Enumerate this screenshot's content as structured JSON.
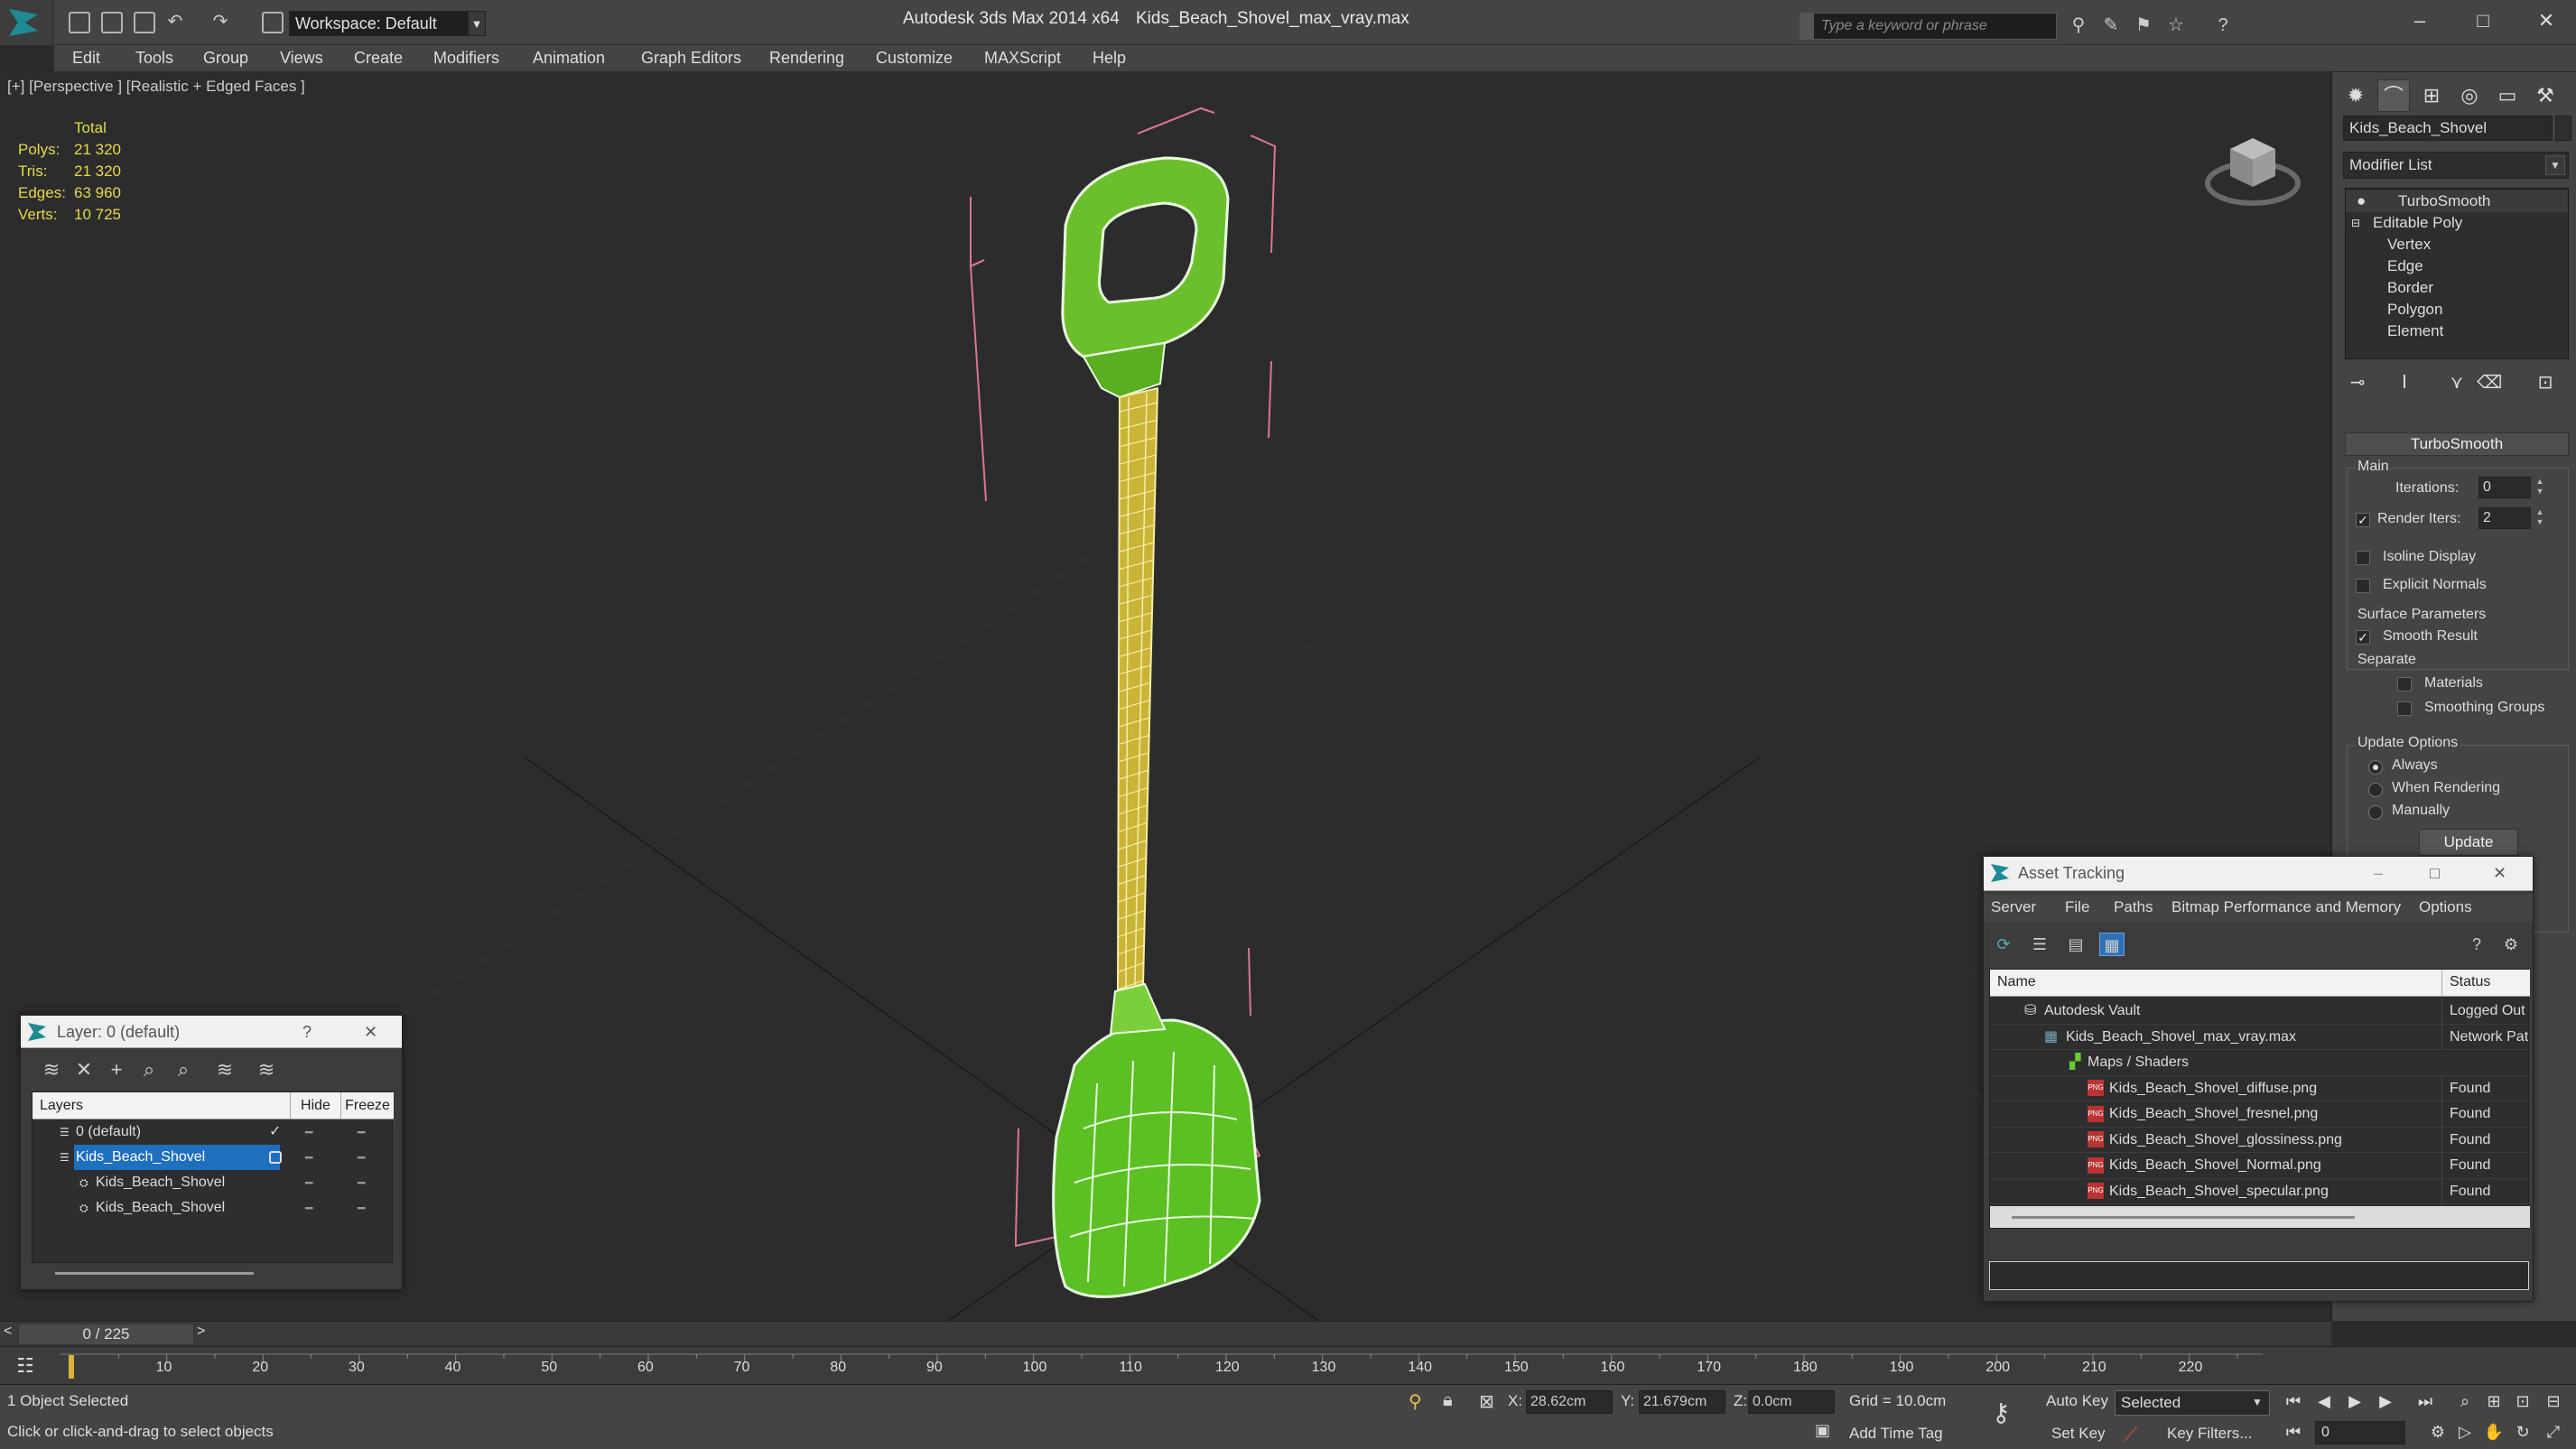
{
  "app": {
    "title": "Autodesk 3ds Max  2014 x64",
    "file": "Kids_Beach_Shovel_max_vray.max",
    "workspace": "Workspace: Default",
    "search_placeholder": "Type a keyword or phrase"
  },
  "menu": [
    "Edit",
    "Tools",
    "Group",
    "Views",
    "Create",
    "Modifiers",
    "Animation",
    "Graph Editors",
    "Rendering",
    "Customize",
    "MAXScript",
    "Help"
  ],
  "viewport": {
    "label": "[+] [Perspective ] [Realistic + Edged Faces ]",
    "stats_header": "Total",
    "stats": [
      {
        "k": "Polys:",
        "v": "21 320"
      },
      {
        "k": "Tris:",
        "v": "21 320"
      },
      {
        "k": "Edges:",
        "v": "63 960"
      },
      {
        "k": "Verts:",
        "v": "10 725"
      }
    ]
  },
  "command_panel": {
    "object_name": "Kids_Beach_Shovel",
    "modifier_list": "Modifier List",
    "stack": [
      {
        "label": "TurboSmooth",
        "icon": "bulb-icon"
      },
      {
        "label": "Editable Poly",
        "icon": "expand-minus-icon"
      },
      {
        "label": "Vertex"
      },
      {
        "label": "Edge"
      },
      {
        "label": "Border"
      },
      {
        "label": "Polygon"
      },
      {
        "label": "Element"
      }
    ],
    "rollout_title": "TurboSmooth",
    "main_group": "Main",
    "iterations_label": "Iterations:",
    "iterations_value": "0",
    "render_iters_label": "Render Iters:",
    "render_iters_value": "2",
    "render_iters_checked": true,
    "isoline_label": "Isoline Display",
    "explicit_label": "Explicit Normals",
    "surface_group": "Surface Parameters",
    "smooth_result_label": "Smooth Result",
    "separate_label": "Separate",
    "materials_label": "Materials",
    "smoothing_groups_label": "Smoothing Groups",
    "update_group": "Update Options",
    "update_options": [
      "Always",
      "When Rendering",
      "Manually"
    ],
    "update_selected": "Always",
    "update_button": "Update"
  },
  "layer_dialog": {
    "title": "Layer: 0 (default)",
    "help": "?",
    "columns": [
      "Layers",
      "Hide",
      "Freeze"
    ],
    "rows": [
      {
        "name": "0 (default)",
        "indent": 1,
        "check": "✓",
        "selected": false
      },
      {
        "name": "Kids_Beach_Shovel",
        "indent": 1,
        "check": "",
        "selected": true
      },
      {
        "name": "Kids_Beach_Shovel",
        "indent": 2,
        "check": "",
        "selected": false
      },
      {
        "name": "Kids_Beach_Shovel",
        "indent": 2,
        "check": "",
        "selected": false
      }
    ]
  },
  "asset_dialog": {
    "title": "Asset Tracking",
    "menu": [
      "Server",
      "File",
      "Paths",
      "Bitmap Performance and Memory",
      "Options"
    ],
    "columns": [
      "Name",
      "Status"
    ],
    "rows": [
      {
        "name": "Autodesk Vault",
        "status": "Logged Out",
        "indent": 1
      },
      {
        "name": "Kids_Beach_Shovel_max_vray.max",
        "status": "Network Pat",
        "indent": 2
      },
      {
        "name": "Maps / Shaders",
        "status": "",
        "indent": 3
      },
      {
        "name": "Kids_Beach_Shovel_diffuse.png",
        "status": "Found",
        "indent": 4
      },
      {
        "name": "Kids_Beach_Shovel_fresnel.png",
        "status": "Found",
        "indent": 4
      },
      {
        "name": "Kids_Beach_Shovel_glossiness.png",
        "status": "Found",
        "indent": 4
      },
      {
        "name": "Kids_Beach_Shovel_Normal.png",
        "status": "Found",
        "indent": 4
      },
      {
        "name": "Kids_Beach_Shovel_specular.png",
        "status": "Found",
        "indent": 4
      }
    ]
  },
  "timeline": {
    "frame_display": "0 / 225",
    "ticks": [
      "10",
      "20",
      "30",
      "40",
      "50",
      "60",
      "70",
      "80",
      "90",
      "100",
      "110",
      "120",
      "130",
      "140",
      "150",
      "160",
      "170",
      "180",
      "190",
      "200",
      "210",
      "220"
    ],
    "tick_values": [
      10,
      20,
      30,
      40,
      50,
      60,
      70,
      80,
      90,
      100,
      110,
      120,
      130,
      140,
      150,
      160,
      170,
      180,
      190,
      200,
      210,
      220
    ],
    "max_frame": 225
  },
  "status": {
    "selection": "1 Object Selected",
    "prompt": "Click or click-and-drag to select objects",
    "x_label": "X:",
    "x_value": "28.62cm",
    "y_label": "Y:",
    "y_value": "21.679cm",
    "z_label": "Z:",
    "z_value": "0.0cm",
    "grid": "Grid = 10.0cm",
    "add_time_tag": "Add Time Tag",
    "auto_key": "Auto Key",
    "set_key": "Set Key",
    "selected_dropdown": "Selected",
    "key_filters": "Key Filters...",
    "current_frame": "0"
  }
}
